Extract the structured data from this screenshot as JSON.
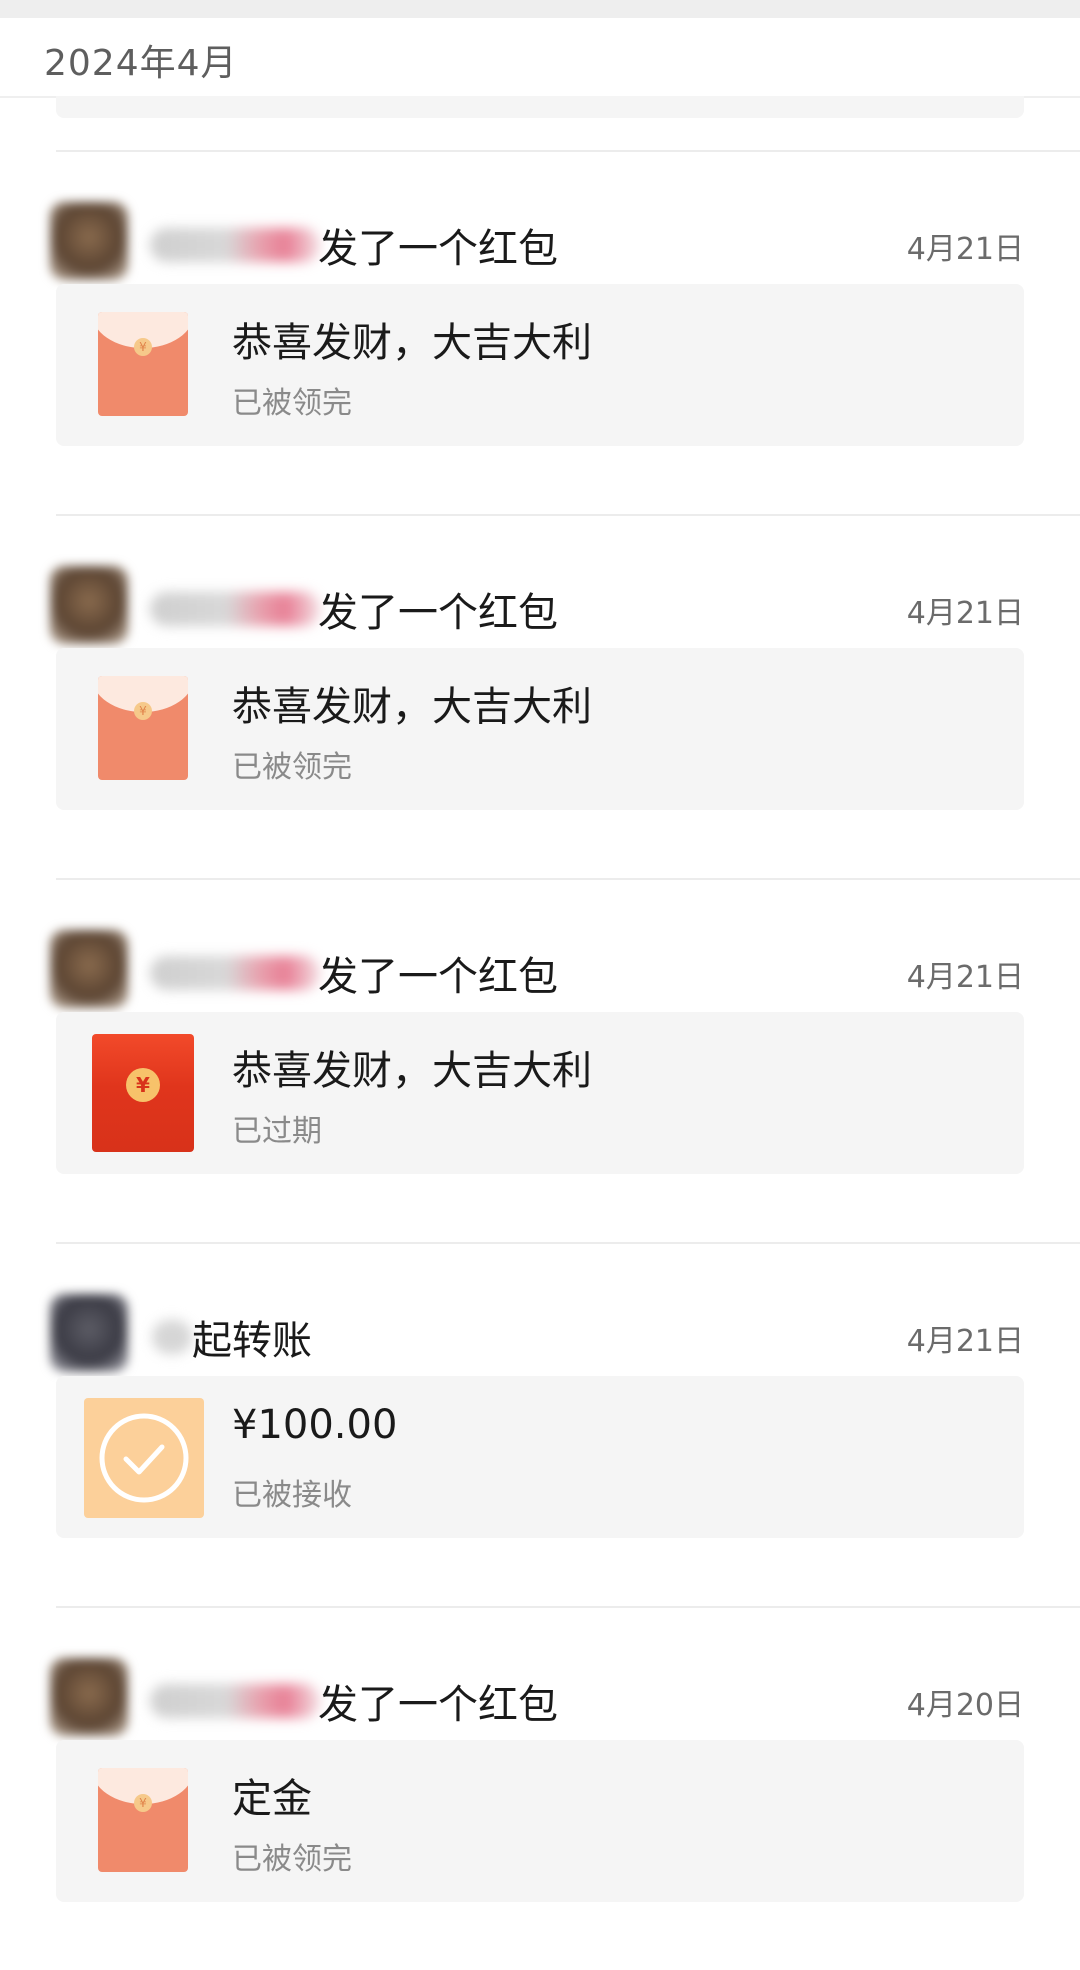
{
  "header": {
    "month": "2024年4月"
  },
  "colors": {
    "red_envelope_received": "#f08a6b",
    "red_envelope_expired": "#e0351c",
    "transfer_icon": "#fcd09a",
    "card_background": "#f5f5f5"
  },
  "entries": [
    {
      "action": "发了一个红包",
      "date": "4月21日",
      "type": "red-envelope",
      "title": "恭喜发财，大吉大利",
      "status": "已被领完"
    },
    {
      "action": "发了一个红包",
      "date": "4月21日",
      "type": "red-envelope",
      "title": "恭喜发财，大吉大利",
      "status": "已被领完"
    },
    {
      "action": "发了一个红包",
      "date": "4月21日",
      "type": "red-envelope-expired",
      "title": "恭喜发财，大吉大利",
      "status": "已过期"
    },
    {
      "action": "起转账",
      "date": "4月21日",
      "type": "transfer",
      "title": "¥100.00",
      "status": "已被接收"
    },
    {
      "action": "发了一个红包",
      "date": "4月20日",
      "type": "red-envelope",
      "title": "定金",
      "status": "已被领完"
    }
  ],
  "icons": {
    "red_envelope": "red-envelope-icon",
    "transfer": "transfer-check-icon",
    "coin": "yuan-coin-icon"
  },
  "coin_symbol": "¥"
}
